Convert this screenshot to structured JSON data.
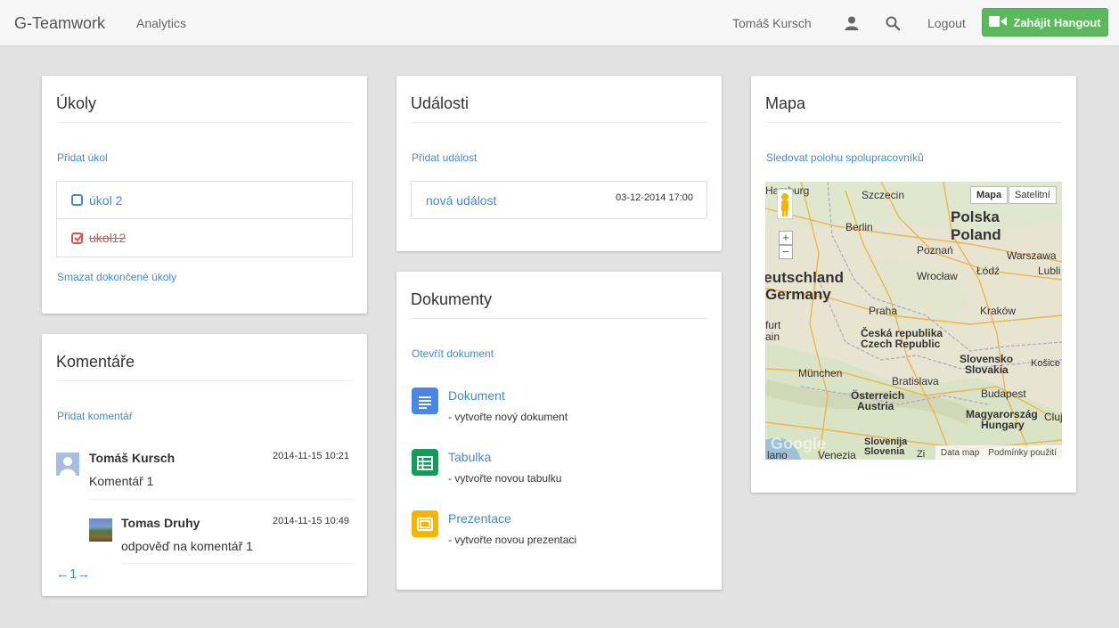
{
  "navbar": {
    "brand": "G-Teamwork",
    "analytics": "Analytics",
    "user_name": "Tomáš Kursch",
    "logout": "Logout",
    "hangout_button": "Zahájit Hangout"
  },
  "tasks": {
    "title": "Úkoly",
    "add_link": "Přidat úkol",
    "items": [
      {
        "label": "úkol 2",
        "done": false
      },
      {
        "label": "ukol12",
        "done": true
      }
    ],
    "clear_done_link": "Smazat dokončené úkoly"
  },
  "comments": {
    "title": "Komentáře",
    "add_link": "Přidat komentář",
    "items": [
      {
        "author": "Tomáš Kursch",
        "date": "2014-11-15 10:21",
        "text": "Komentář 1"
      },
      {
        "author": "Tomas Druhy",
        "date": "2014-11-15 10:49",
        "text": "odpověď na komentář 1"
      }
    ],
    "pager": {
      "prev": "←",
      "page": "1",
      "next": "→"
    }
  },
  "events": {
    "title": "Události",
    "add_link": "Přidat událost",
    "items": [
      {
        "name": "nová událost",
        "datetime": "03-12-2014 17:00"
      }
    ]
  },
  "documents": {
    "title": "Dokumenty",
    "open_link": "Otevřít dokument",
    "items": [
      {
        "title": "Dokument",
        "desc": "- vytvořte nový dokument",
        "icon": "google-docs-icon",
        "color": "#4a86e8"
      },
      {
        "title": "Tabulka",
        "desc": "- vytvořte novou tabulku",
        "icon": "google-sheets-icon",
        "color": "#0f9d58"
      },
      {
        "title": "Prezentace",
        "desc": "- vytvořte novou prezentaci",
        "icon": "google-slides-icon",
        "color": "#f4b400"
      }
    ]
  },
  "map": {
    "title": "Mapa",
    "track_link": "Sledovat polohu spolupracovníků",
    "type_map": "Mapa",
    "type_satellite": "Satelitní",
    "zoom_in": "+",
    "zoom_out": "−",
    "footer_data": "Data map",
    "footer_terms": "Podmínky použití",
    "logo": "Google",
    "labels": {
      "hamburg": "Hamburg",
      "szczecin": "Szczecin",
      "berlin": "Berlin",
      "polska": "Polska",
      "poland": "Poland",
      "poznan": "Poznań",
      "warszawa": "Warszawa",
      "lodz": "Łódź",
      "lublin": "Lubli",
      "deutschland": "Deutschland",
      "germany": "Germany",
      "wroclaw": "Wrocław",
      "praha": "Praha",
      "krakow": "Kraków",
      "frankfurt": "furt",
      "main": "ain",
      "ceska": "Česká republika",
      "czech": "Czech Republic",
      "slovensko": "Slovensko",
      "slovakia": "Slovakia",
      "kosice": "Košice",
      "munchen": "München",
      "bratislava": "Bratislava",
      "osterreich": "Österreich",
      "austria": "Austria",
      "budapest": "Budapest",
      "magyarorszag": "Magyarország",
      "hungary": "Hungary",
      "cluj": "Cluj",
      "slovenija1": "Slovenija",
      "slovenija2": "Slovenia",
      "venezia": "Venezia",
      "milano": "lano",
      "zagreb": "Zi"
    }
  },
  "colors": {
    "accent": "#428bca",
    "hangout_green": "#5cb85c",
    "done_red": "#d9534f"
  }
}
